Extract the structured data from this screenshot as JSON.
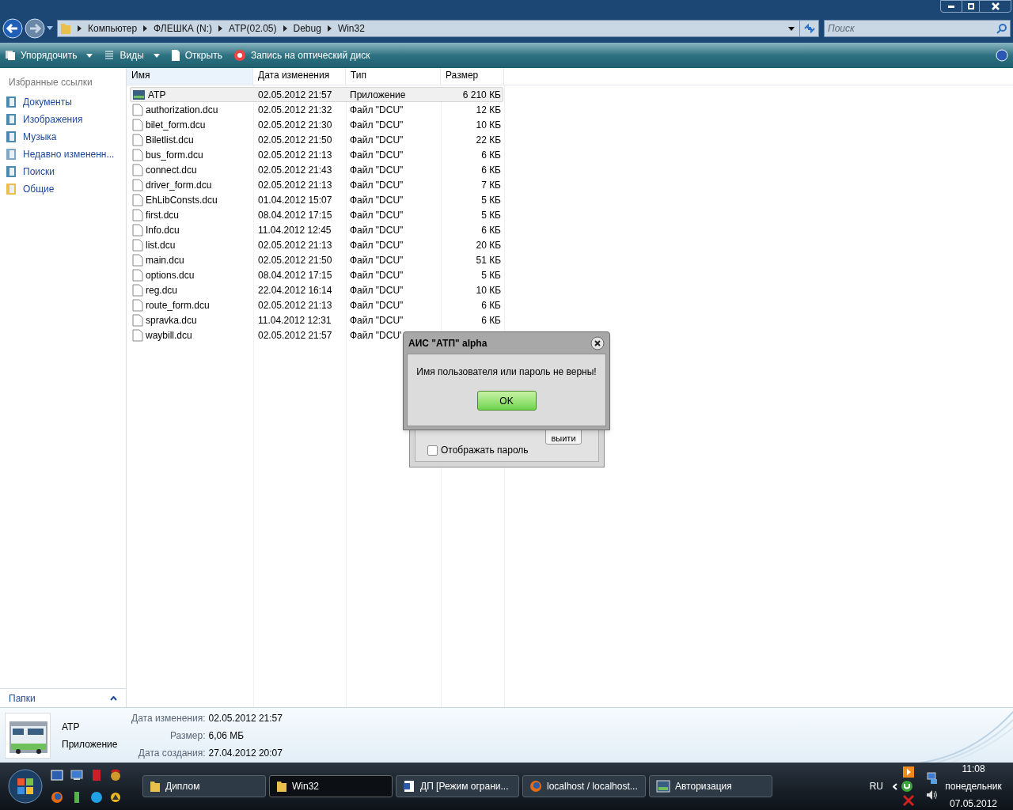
{
  "address_bar": {
    "crumbs": [
      "Компьютер",
      "ФЛЕШКА (N:)",
      "ATP(02.05)",
      "Debug",
      "Win32"
    ]
  },
  "search": {
    "placeholder": "Поиск"
  },
  "toolbar": {
    "items": [
      {
        "label": "Упорядочить",
        "kind": "dropdown"
      },
      {
        "label": "Виды",
        "kind": "dropdown"
      },
      {
        "label": "Открыть",
        "kind": "plain"
      },
      {
        "label": "Запись на оптический диск",
        "kind": "burn"
      }
    ]
  },
  "sidebar": {
    "heading": "Избранные ссылки",
    "items": [
      "Документы",
      "Изображения",
      "Музыка",
      "Недавно измененн...",
      "Поиски",
      "Общие"
    ],
    "footer": "Папки"
  },
  "table": {
    "columns": [
      "Имя",
      "Дата изменения",
      "Тип",
      "Размер"
    ],
    "rows": [
      {
        "name": "ATP",
        "date": "02.05.2012 21:57",
        "type": "Приложение",
        "size": "6 210 КБ",
        "kind": "app",
        "selected": true
      },
      {
        "name": "authorization.dcu",
        "date": "02.05.2012 21:32",
        "type": "Файл \"DCU\"",
        "size": "12 КБ",
        "kind": "file",
        "selected": false
      },
      {
        "name": "bilet_form.dcu",
        "date": "02.05.2012 21:30",
        "type": "Файл \"DCU\"",
        "size": "10 КБ",
        "kind": "file",
        "selected": false
      },
      {
        "name": "Biletlist.dcu",
        "date": "02.05.2012 21:50",
        "type": "Файл \"DCU\"",
        "size": "22 КБ",
        "kind": "file",
        "selected": false
      },
      {
        "name": "bus_form.dcu",
        "date": "02.05.2012 21:13",
        "type": "Файл \"DCU\"",
        "size": "6 КБ",
        "kind": "file",
        "selected": false
      },
      {
        "name": "connect.dcu",
        "date": "02.05.2012 21:43",
        "type": "Файл \"DCU\"",
        "size": "6 КБ",
        "kind": "file",
        "selected": false
      },
      {
        "name": "driver_form.dcu",
        "date": "02.05.2012 21:13",
        "type": "Файл \"DCU\"",
        "size": "7 КБ",
        "kind": "file",
        "selected": false
      },
      {
        "name": "EhLibConsts.dcu",
        "date": "01.04.2012 15:07",
        "type": "Файл \"DCU\"",
        "size": "5 КБ",
        "kind": "file",
        "selected": false
      },
      {
        "name": "first.dcu",
        "date": "08.04.2012 17:15",
        "type": "Файл \"DCU\"",
        "size": "5 КБ",
        "kind": "file",
        "selected": false
      },
      {
        "name": "Info.dcu",
        "date": "11.04.2012 12:45",
        "type": "Файл \"DCU\"",
        "size": "6 КБ",
        "kind": "file",
        "selected": false
      },
      {
        "name": "list.dcu",
        "date": "02.05.2012 21:13",
        "type": "Файл \"DCU\"",
        "size": "20 КБ",
        "kind": "file",
        "selected": false
      },
      {
        "name": "main.dcu",
        "date": "02.05.2012 21:50",
        "type": "Файл \"DCU\"",
        "size": "51 КБ",
        "kind": "file",
        "selected": false
      },
      {
        "name": "options.dcu",
        "date": "08.04.2012 17:15",
        "type": "Файл \"DCU\"",
        "size": "5 КБ",
        "kind": "file",
        "selected": false
      },
      {
        "name": "reg.dcu",
        "date": "22.04.2012 16:14",
        "type": "Файл \"DCU\"",
        "size": "10 КБ",
        "kind": "file",
        "selected": false
      },
      {
        "name": "route_form.dcu",
        "date": "02.05.2012 21:13",
        "type": "Файл \"DCU\"",
        "size": "6 КБ",
        "kind": "file",
        "selected": false
      },
      {
        "name": "spravka.dcu",
        "date": "11.04.2012 12:31",
        "type": "Файл \"DCU\"",
        "size": "6 КБ",
        "kind": "file",
        "selected": false
      },
      {
        "name": "waybill.dcu",
        "date": "02.05.2012 21:57",
        "type": "Файл \"DCU'",
        "kind": "file",
        "selected": false
      }
    ]
  },
  "details": {
    "name": "ATP",
    "type": "Приложение",
    "fields": [
      {
        "label": "Дата изменения:",
        "value": "02.05.2012 21:57"
      },
      {
        "label": "Размер:",
        "value": "6,06 МБ"
      },
      {
        "label": "Дата создания:",
        "value": "27.04.2012 20:07"
      }
    ]
  },
  "login_window": {
    "button": "выити",
    "checkbox": {
      "label": "Отображать пароль",
      "checked": false
    }
  },
  "message_box": {
    "title": "АИС \"АТП\" alpha",
    "message": "Имя пользователя или пароль не верны!",
    "button": "OK"
  },
  "taskbar": {
    "buttons": [
      {
        "label": "Диплом",
        "kind": "folder",
        "selected": false
      },
      {
        "label": "Win32",
        "kind": "folder",
        "selected": true
      },
      {
        "label": "ДП [Режим ограни...",
        "kind": "word",
        "selected": false
      },
      {
        "label": "localhost / localhost...",
        "kind": "browser",
        "selected": false
      },
      {
        "label": "Авторизация",
        "kind": "app",
        "selected": false
      }
    ],
    "language": "RU",
    "time": "11:08",
    "day": "понедельник",
    "date": "07.05.2012"
  }
}
